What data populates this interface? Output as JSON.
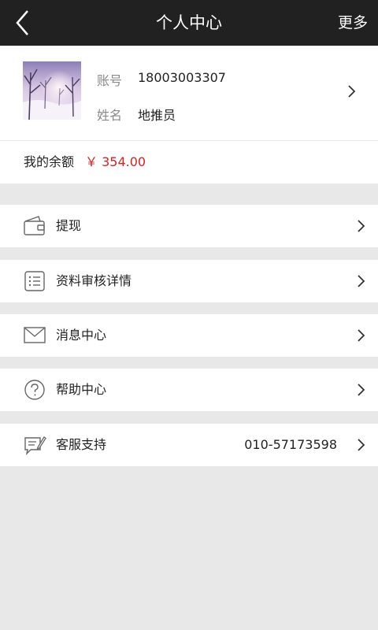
{
  "header": {
    "title": "个人中心",
    "more_label": "更多",
    "back_icon": "back-icon"
  },
  "profile": {
    "account_label": "账号",
    "account_value": "18003003307",
    "name_label": "姓名",
    "name_value": "地推员"
  },
  "balance": {
    "label": "我的余额",
    "value": "￥ 354.00",
    "color": "#d9211f"
  },
  "menu": [
    {
      "label": "提现",
      "icon": "wallet-icon"
    },
    {
      "label": "资料审核详情",
      "icon": "list-document-icon"
    },
    {
      "label": "消息中心",
      "icon": "envelope-icon"
    },
    {
      "label": "帮助中心",
      "icon": "question-circle-icon"
    },
    {
      "label": "客服支持",
      "value": "010-57173598",
      "icon": "customer-service-icon"
    }
  ]
}
